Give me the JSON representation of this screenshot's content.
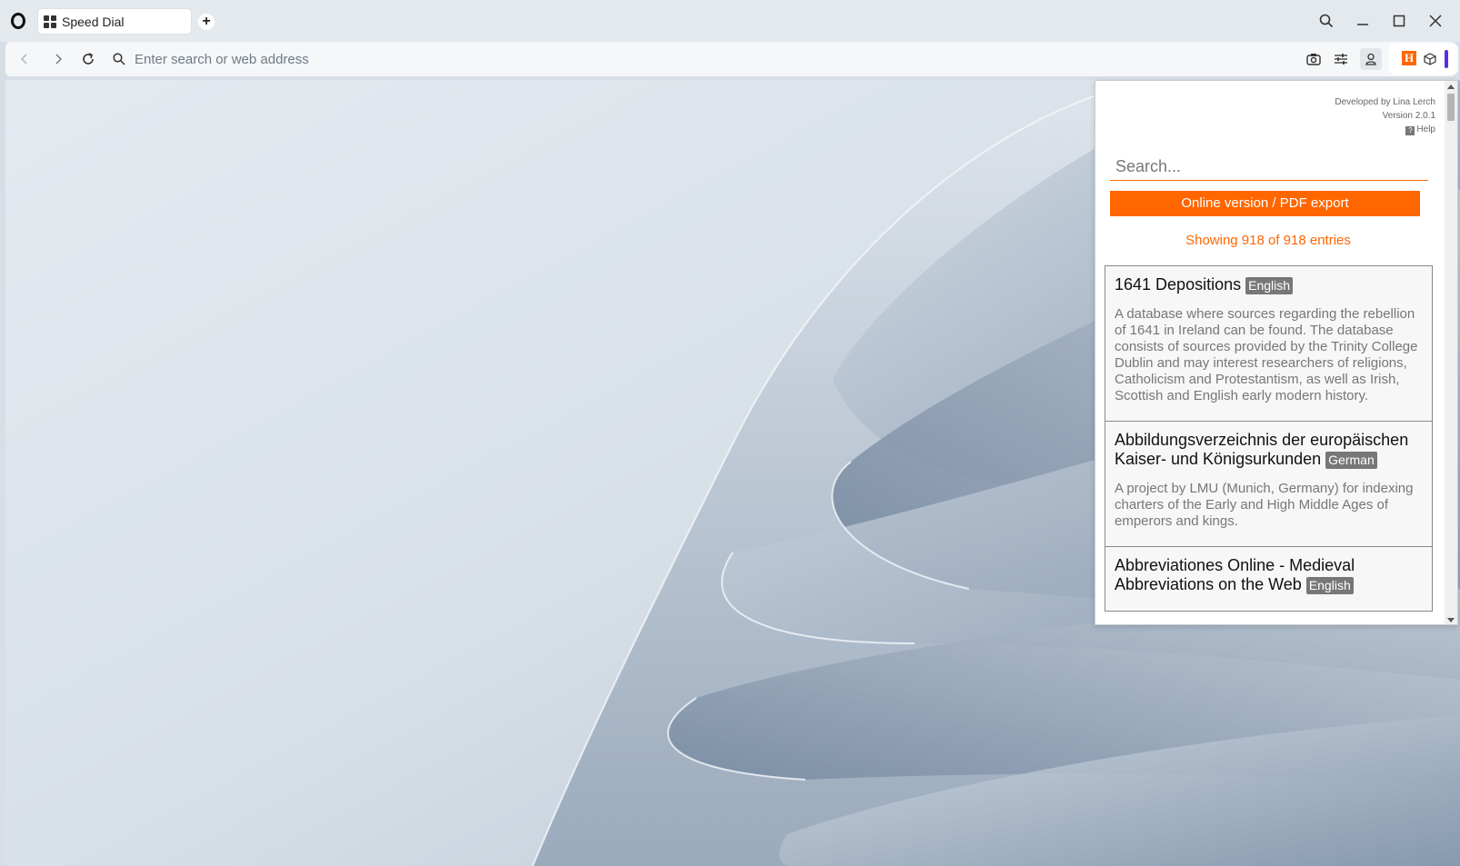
{
  "browser": {
    "tab_title": "Speed Dial",
    "address_placeholder": "Enter search or web address"
  },
  "extension": {
    "developer": "Developed by Lina Lerch",
    "version": "Version 2.0.1",
    "help_label": "Help",
    "search_placeholder": "Search...",
    "export_label": "Online version / PDF export",
    "count_text": "Showing 918 of 918 entries",
    "entries": [
      {
        "title": "1641 Depositions",
        "language": "English",
        "description": "A database where sources regarding the rebellion of 1641 in Ireland can be found. The database consists of sources provided by the Trinity College Dublin and may interest researchers of religions, Catholicism and Protestantism, as well as Irish, Scottish and English early modern history."
      },
      {
        "title": "Abbildungsverzeichnis der europäischen Kaiser- und Königsurkunden",
        "language": "German",
        "description": "A project by LMU (Munich, Germany) for indexing charters of the Early and High Middle Ages of emperors and kings."
      },
      {
        "title": "Abbreviationes Online - Medieval Abbreviations on the Web",
        "language": "English",
        "description": ""
      }
    ]
  },
  "colors": {
    "accent": "#ff6600",
    "badge": "#777777",
    "extension_bar": "#5b2ee0"
  }
}
